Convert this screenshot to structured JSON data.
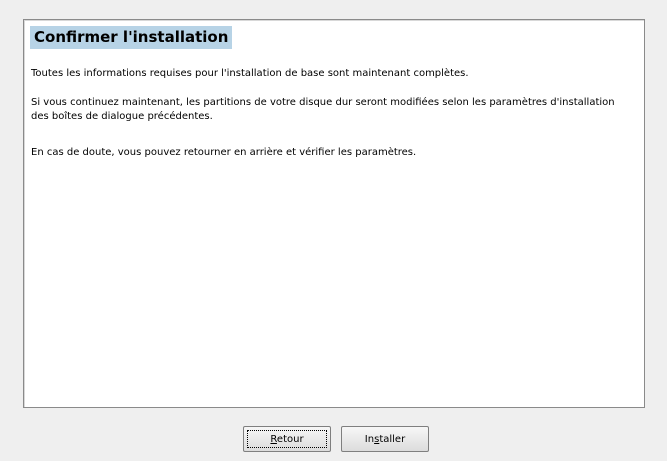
{
  "dialog": {
    "title": "Confirmer l'installation",
    "paragraphs": [
      "Toutes les informations requises pour l'installation de base sont maintenant complètes.",
      "Si vous continuez maintenant, les partitions de votre disque dur seront modifiées selon les paramètres d'installation des boîtes de dialogue précédentes.",
      "En cas de doute, vous pouvez retourner en arrière et vérifier les paramètres."
    ]
  },
  "buttons": {
    "back": {
      "label": "Retour",
      "mnemonic_index": 0
    },
    "install": {
      "label": "Installer",
      "mnemonic_index": 2
    }
  },
  "colors": {
    "title_highlight": "#b7d3e6",
    "panel_background": "#ffffff",
    "window_background": "#efefef"
  }
}
